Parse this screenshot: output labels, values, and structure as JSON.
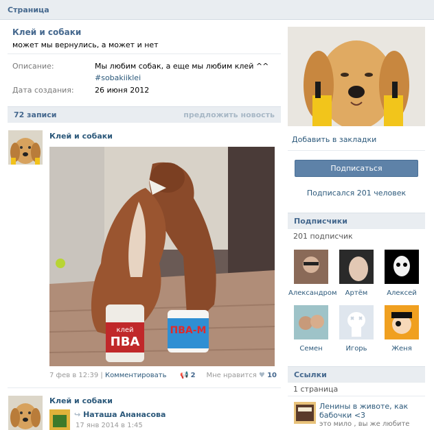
{
  "header": {
    "title": "Страница"
  },
  "group": {
    "name": "Клей и собаки",
    "status": "может мы вернулись, а может и нет",
    "description_label": "Описание:",
    "description": "Мы любим собак, а еще мы любим клей ^^",
    "hashtag": "#sobakiiklei",
    "created_label": "Дата создания:",
    "created": "26 июня 2012"
  },
  "posts_bar": {
    "count": "72 записи",
    "suggest": "предложить новость"
  },
  "post": {
    "author": "Клей и собаки",
    "glue_label_1": "клей",
    "glue_brand_1": "ПВА",
    "glue_brand_2": "ПВА-М",
    "date": "7 фев в 12:39",
    "divider": "|",
    "comment": "Комментировать",
    "reposts": "2",
    "like_label": "Мне нравится",
    "likes": "10"
  },
  "post2": {
    "author": "Клей и собаки",
    "repost_author": "Наташа Ананасова",
    "repost_date": "17 янв 2014 в 1:45"
  },
  "sidebar": {
    "bookmark": "Добавить в закладки",
    "subscribe": "Подписаться",
    "subscribed_count": "Подписался 201 человек",
    "subscribers_title": "Подписчики",
    "subscribers_count": "201 подписчик",
    "members": [
      {
        "name": "Александром"
      },
      {
        "name": "Артём"
      },
      {
        "name": "Алексей"
      },
      {
        "name": "Семен"
      },
      {
        "name": "Игорь"
      },
      {
        "name": "Женя"
      }
    ],
    "links_title": "Ссылки",
    "links_count": "1 страница",
    "link_title": "Ленины в животе, как бабочки <3",
    "link_desc": "это мило , вы же любите"
  },
  "colors": {
    "link": "#2b587a",
    "header": "#45688e",
    "button": "#5e82a8",
    "bar": "#e9edf1"
  }
}
